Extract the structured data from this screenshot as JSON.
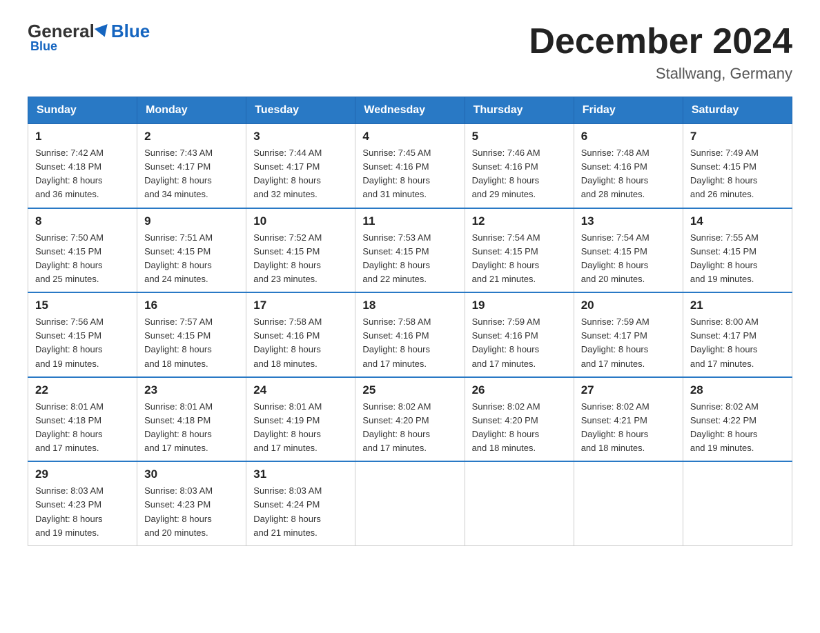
{
  "header": {
    "logo_general": "General",
    "logo_blue": "Blue",
    "main_title": "December 2024",
    "subtitle": "Stallwang, Germany"
  },
  "days_of_week": [
    "Sunday",
    "Monday",
    "Tuesday",
    "Wednesday",
    "Thursday",
    "Friday",
    "Saturday"
  ],
  "weeks": [
    [
      {
        "day": "1",
        "sunrise": "7:42 AM",
        "sunset": "4:18 PM",
        "daylight": "8 hours and 36 minutes."
      },
      {
        "day": "2",
        "sunrise": "7:43 AM",
        "sunset": "4:17 PM",
        "daylight": "8 hours and 34 minutes."
      },
      {
        "day": "3",
        "sunrise": "7:44 AM",
        "sunset": "4:17 PM",
        "daylight": "8 hours and 32 minutes."
      },
      {
        "day": "4",
        "sunrise": "7:45 AM",
        "sunset": "4:16 PM",
        "daylight": "8 hours and 31 minutes."
      },
      {
        "day": "5",
        "sunrise": "7:46 AM",
        "sunset": "4:16 PM",
        "daylight": "8 hours and 29 minutes."
      },
      {
        "day": "6",
        "sunrise": "7:48 AM",
        "sunset": "4:16 PM",
        "daylight": "8 hours and 28 minutes."
      },
      {
        "day": "7",
        "sunrise": "7:49 AM",
        "sunset": "4:15 PM",
        "daylight": "8 hours and 26 minutes."
      }
    ],
    [
      {
        "day": "8",
        "sunrise": "7:50 AM",
        "sunset": "4:15 PM",
        "daylight": "8 hours and 25 minutes."
      },
      {
        "day": "9",
        "sunrise": "7:51 AM",
        "sunset": "4:15 PM",
        "daylight": "8 hours and 24 minutes."
      },
      {
        "day": "10",
        "sunrise": "7:52 AM",
        "sunset": "4:15 PM",
        "daylight": "8 hours and 23 minutes."
      },
      {
        "day": "11",
        "sunrise": "7:53 AM",
        "sunset": "4:15 PM",
        "daylight": "8 hours and 22 minutes."
      },
      {
        "day": "12",
        "sunrise": "7:54 AM",
        "sunset": "4:15 PM",
        "daylight": "8 hours and 21 minutes."
      },
      {
        "day": "13",
        "sunrise": "7:54 AM",
        "sunset": "4:15 PM",
        "daylight": "8 hours and 20 minutes."
      },
      {
        "day": "14",
        "sunrise": "7:55 AM",
        "sunset": "4:15 PM",
        "daylight": "8 hours and 19 minutes."
      }
    ],
    [
      {
        "day": "15",
        "sunrise": "7:56 AM",
        "sunset": "4:15 PM",
        "daylight": "8 hours and 19 minutes."
      },
      {
        "day": "16",
        "sunrise": "7:57 AM",
        "sunset": "4:15 PM",
        "daylight": "8 hours and 18 minutes."
      },
      {
        "day": "17",
        "sunrise": "7:58 AM",
        "sunset": "4:16 PM",
        "daylight": "8 hours and 18 minutes."
      },
      {
        "day": "18",
        "sunrise": "7:58 AM",
        "sunset": "4:16 PM",
        "daylight": "8 hours and 17 minutes."
      },
      {
        "day": "19",
        "sunrise": "7:59 AM",
        "sunset": "4:16 PM",
        "daylight": "8 hours and 17 minutes."
      },
      {
        "day": "20",
        "sunrise": "7:59 AM",
        "sunset": "4:17 PM",
        "daylight": "8 hours and 17 minutes."
      },
      {
        "day": "21",
        "sunrise": "8:00 AM",
        "sunset": "4:17 PM",
        "daylight": "8 hours and 17 minutes."
      }
    ],
    [
      {
        "day": "22",
        "sunrise": "8:01 AM",
        "sunset": "4:18 PM",
        "daylight": "8 hours and 17 minutes."
      },
      {
        "day": "23",
        "sunrise": "8:01 AM",
        "sunset": "4:18 PM",
        "daylight": "8 hours and 17 minutes."
      },
      {
        "day": "24",
        "sunrise": "8:01 AM",
        "sunset": "4:19 PM",
        "daylight": "8 hours and 17 minutes."
      },
      {
        "day": "25",
        "sunrise": "8:02 AM",
        "sunset": "4:20 PM",
        "daylight": "8 hours and 17 minutes."
      },
      {
        "day": "26",
        "sunrise": "8:02 AM",
        "sunset": "4:20 PM",
        "daylight": "8 hours and 18 minutes."
      },
      {
        "day": "27",
        "sunrise": "8:02 AM",
        "sunset": "4:21 PM",
        "daylight": "8 hours and 18 minutes."
      },
      {
        "day": "28",
        "sunrise": "8:02 AM",
        "sunset": "4:22 PM",
        "daylight": "8 hours and 19 minutes."
      }
    ],
    [
      {
        "day": "29",
        "sunrise": "8:03 AM",
        "sunset": "4:23 PM",
        "daylight": "8 hours and 19 minutes."
      },
      {
        "day": "30",
        "sunrise": "8:03 AM",
        "sunset": "4:23 PM",
        "daylight": "8 hours and 20 minutes."
      },
      {
        "day": "31",
        "sunrise": "8:03 AM",
        "sunset": "4:24 PM",
        "daylight": "8 hours and 21 minutes."
      },
      null,
      null,
      null,
      null
    ]
  ],
  "labels": {
    "sunrise": "Sunrise:",
    "sunset": "Sunset:",
    "daylight": "Daylight:"
  }
}
